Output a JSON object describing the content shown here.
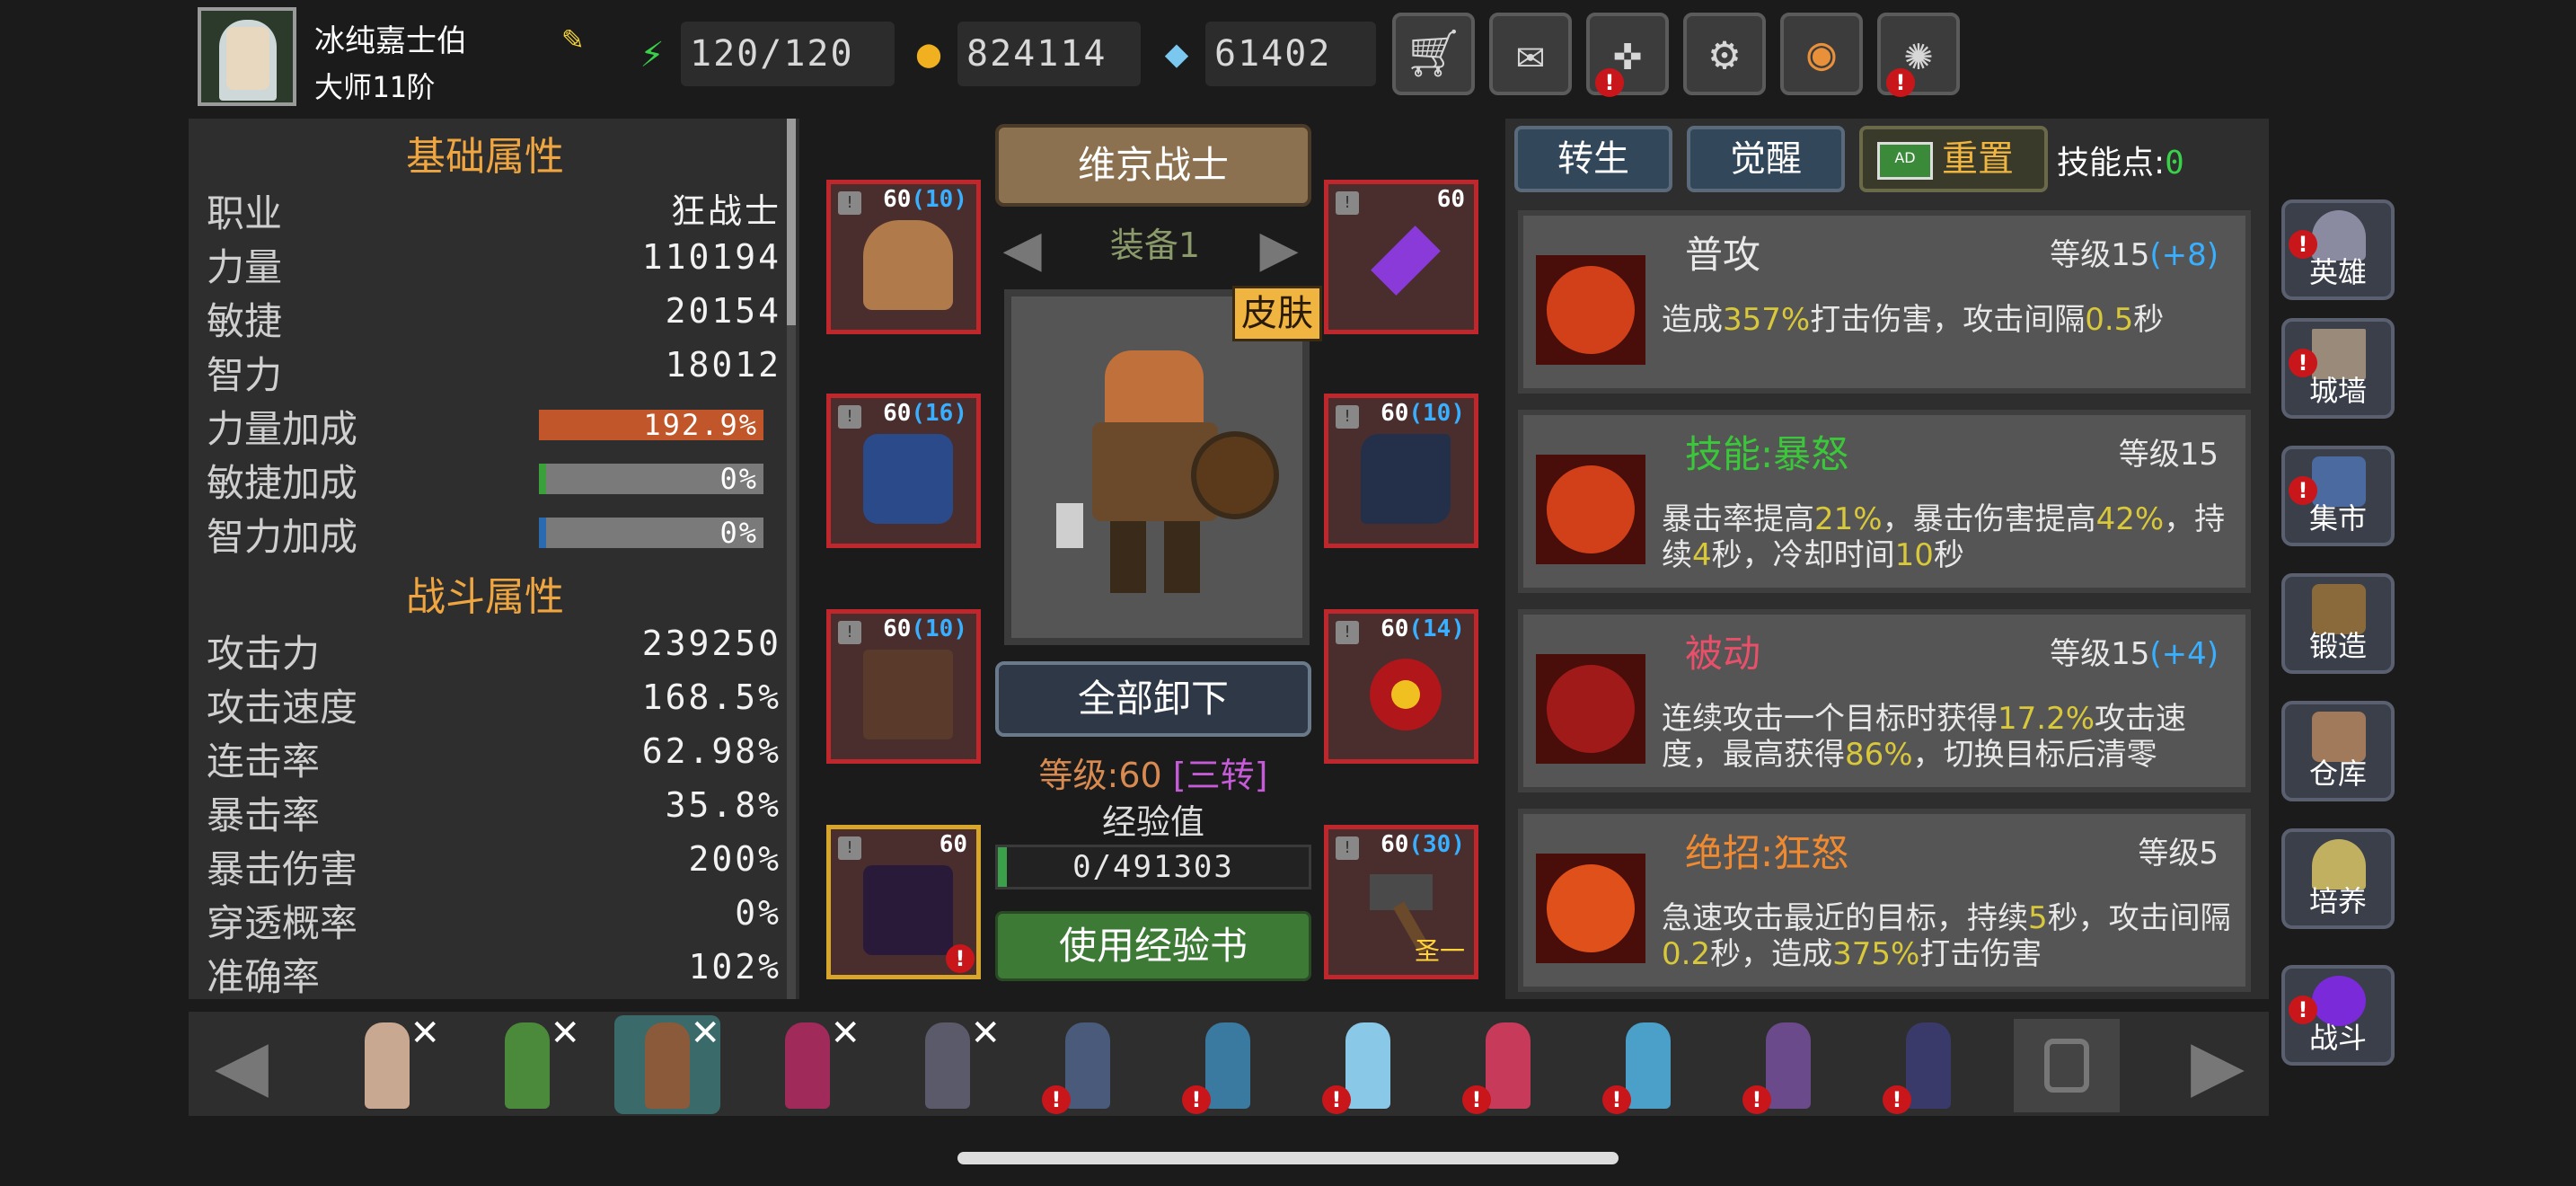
{
  "header": {
    "player_name": "冰纯嘉士伯",
    "player_rank": "大师11阶",
    "energy": "120/120",
    "gold": "824114",
    "gems": "61402",
    "icons": [
      "edit-icon",
      "energy-icon",
      "gold-coin-icon",
      "gem-icon",
      "cart-icon",
      "mail-icon",
      "gamepad-icon",
      "gear-icon",
      "camera-shutter-icon",
      "fireworks-icon"
    ]
  },
  "basic_stats": {
    "title": "基础属性",
    "rows": [
      {
        "label": "职业",
        "value": "狂战士"
      },
      {
        "label": "力量",
        "value": "110194"
      },
      {
        "label": "敏捷",
        "value": "20154"
      },
      {
        "label": "智力",
        "value": "18012"
      }
    ],
    "bonuses": [
      {
        "label": "力量加成",
        "value": "192.9%",
        "fill": 1.0,
        "color": "#c0562a"
      },
      {
        "label": "敏捷加成",
        "value": "0%",
        "fill": 0.0,
        "color": "#3aa03a"
      },
      {
        "label": "智力加成",
        "value": "0%",
        "fill": 0.0,
        "color": "#2a6ab0"
      }
    ]
  },
  "combat_stats": {
    "title": "战斗属性",
    "rows": [
      {
        "label": "攻击力",
        "value": "239250"
      },
      {
        "label": "攻击速度",
        "value": "168.5%"
      },
      {
        "label": "连击率",
        "value": "62.98%"
      },
      {
        "label": "暴击率",
        "value": "35.8%"
      },
      {
        "label": "暴击伤害",
        "value": "200%"
      },
      {
        "label": "穿透概率",
        "value": "0%"
      },
      {
        "label": "准确率",
        "value": "102%"
      }
    ]
  },
  "equipment": {
    "class_banner": "维京战士",
    "set_label": "装备1",
    "skin_label": "皮肤",
    "unequip_all": "全部卸下",
    "level_text": "等级:60",
    "rebirth_text": "[三转]",
    "exp_title": "经验值",
    "exp_value": "0/491303",
    "use_exp_book": "使用经验书",
    "slots": [
      {
        "name": "helmet",
        "level": "60",
        "bonus": "(10)",
        "tag": ""
      },
      {
        "name": "amulet",
        "level": "60",
        "bonus": "",
        "tag": ""
      },
      {
        "name": "armor",
        "level": "60",
        "bonus": "(16)",
        "tag": ""
      },
      {
        "name": "gloves",
        "level": "60",
        "bonus": "(10)",
        "tag": ""
      },
      {
        "name": "pants",
        "level": "60",
        "bonus": "(10)",
        "tag": ""
      },
      {
        "name": "ring",
        "level": "60",
        "bonus": "(14)",
        "tag": ""
      },
      {
        "name": "boots",
        "level": "60",
        "bonus": "",
        "tag": ""
      },
      {
        "name": "weapon",
        "level": "60",
        "bonus": "(30)",
        "tag": "圣一"
      }
    ]
  },
  "skills_panel": {
    "rebirth_tab": "转生",
    "awaken_tab": "觉醒",
    "reset_button": "重置",
    "reset_tv": "AD",
    "skill_points_label": "技能点:",
    "skill_points_value": "0",
    "skills": [
      {
        "name": "普攻",
        "name_color": "#e8e8e8",
        "level": "等级15",
        "level_bonus": "(+8)",
        "desc_parts": [
          "造成",
          "357%",
          "打击伤害，攻击间隔",
          "0.5",
          "秒"
        ]
      },
      {
        "name": "技能:暴怒",
        "name_color": "#3ac83a",
        "level": "等级15",
        "level_bonus": "",
        "desc_parts": [
          "暴击率提高",
          "21%",
          "，暴击伤害提高",
          "42%",
          "，持续",
          "4",
          "秒，冷却时间",
          "10",
          "秒"
        ]
      },
      {
        "name": "被动",
        "name_color": "#e8506a",
        "level": "等级15",
        "level_bonus": "(+4)",
        "desc_parts": [
          "连续攻击一个目标时获得",
          "17.2%",
          "攻击速度，最高获得",
          "86%",
          "，切换目标后清零"
        ]
      },
      {
        "name": "绝招:狂怒",
        "name_color": "#f08a30",
        "level": "等级5",
        "level_bonus": "",
        "desc_parts": [
          "急速攻击最近的目标，持续",
          "5",
          "秒，攻击间隔",
          "0.2",
          "秒，造成",
          "375%",
          "打击伤害"
        ]
      }
    ]
  },
  "right_nav": [
    {
      "label": "英雄",
      "alert": true
    },
    {
      "label": "城墙",
      "alert": true
    },
    {
      "label": "集市",
      "alert": true
    },
    {
      "label": "锻造",
      "alert": false
    },
    {
      "label": "仓库",
      "alert": false
    },
    {
      "label": "培养",
      "alert": false
    },
    {
      "label": "战斗",
      "alert": true
    }
  ],
  "heroes": [
    {
      "color": "#c8a890",
      "x": true,
      "alert": false,
      "selected": false
    },
    {
      "color": "#4a8a3a",
      "x": true,
      "alert": false,
      "selected": false
    },
    {
      "color": "#8a5a3a",
      "x": true,
      "alert": false,
      "selected": true
    },
    {
      "color": "#a02a5a",
      "x": true,
      "alert": false,
      "selected": false
    },
    {
      "color": "#5a5a6a",
      "x": true,
      "alert": false,
      "selected": false
    },
    {
      "color": "#4a5a7a",
      "x": false,
      "alert": true,
      "selected": false
    },
    {
      "color": "#3a7aa0",
      "x": false,
      "alert": true,
      "selected": false
    },
    {
      "color": "#8ac8e8",
      "x": false,
      "alert": true,
      "selected": false
    },
    {
      "color": "#c83a5a",
      "x": false,
      "alert": true,
      "selected": false
    },
    {
      "color": "#4aa0c8",
      "x": false,
      "alert": true,
      "selected": false
    },
    {
      "color": "#6a4a8a",
      "x": false,
      "alert": true,
      "selected": false
    },
    {
      "color": "#3a3a6a",
      "x": false,
      "alert": true,
      "selected": false
    }
  ]
}
